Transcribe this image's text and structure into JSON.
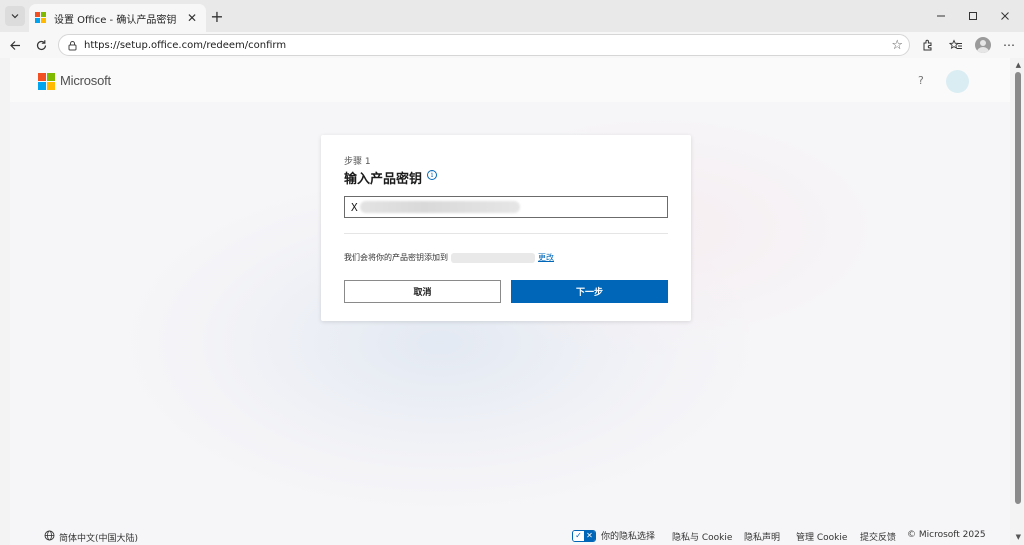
{
  "browser": {
    "tab_title": "设置 Office - 确认产品密钥",
    "url": "https://setup.office.com/redeem/confirm",
    "icons": [
      "tab-list-icon",
      "close-icon",
      "plus-icon",
      "minimize-icon",
      "maximize-icon",
      "window-close-icon",
      "back-arrow-icon",
      "refresh-icon",
      "lock-icon",
      "star-icon",
      "extensions-icon",
      "favorites-icon",
      "profile-icon",
      "more-icon"
    ]
  },
  "header": {
    "brand": "Microsoft",
    "help": "?"
  },
  "card": {
    "step": "步骤 1",
    "title": "输入产品密钥",
    "info": "i",
    "key_prefix": "X",
    "notice_before": "我们会将你的产品密钥添加到",
    "change_link": "更改",
    "cancel": "取消",
    "next": "下一步"
  },
  "footer": {
    "language": "简体中文(中国大陆)",
    "privacy_choices": "你的隐私选择",
    "privacy_cookie": "隐私与 Cookie",
    "privacy_statement": "隐私声明",
    "manage_cookie": "管理 Cookie",
    "feedback": "提交反馈",
    "copyright": "© Microsoft 2025"
  },
  "colors": {
    "ms_red": "#f25022",
    "ms_green": "#7fba00",
    "ms_blue": "#00a4ef",
    "ms_yellow": "#ffb900",
    "accent": "#0067b8"
  }
}
